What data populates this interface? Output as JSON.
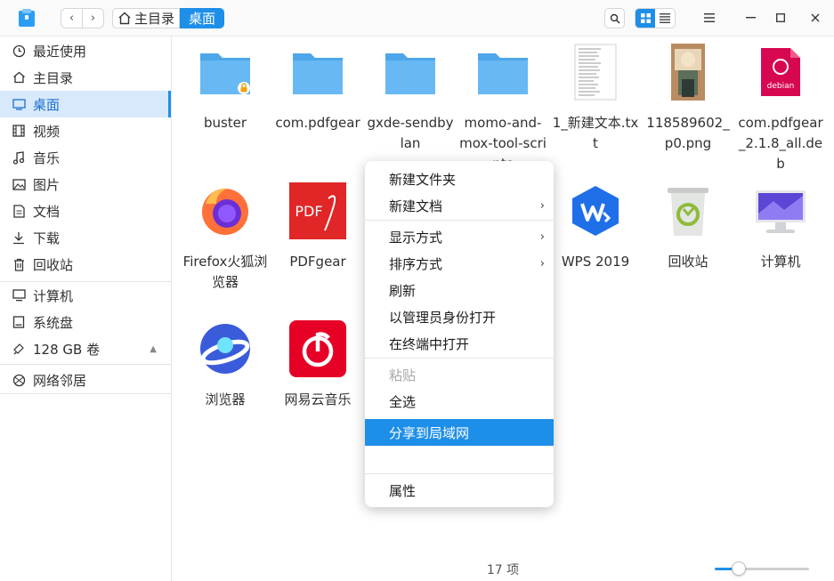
{
  "titlebar": {
    "breadcrumb_home": "主目录",
    "breadcrumb_current": "桌面"
  },
  "sidebar": {
    "items": [
      {
        "label": "最近使用",
        "icon": "clock-icon"
      },
      {
        "label": "主目录",
        "icon": "home-icon"
      },
      {
        "label": "桌面",
        "icon": "desktop-icon"
      },
      {
        "label": "视频",
        "icon": "video-icon"
      },
      {
        "label": "音乐",
        "icon": "music-icon"
      },
      {
        "label": "图片",
        "icon": "picture-icon"
      },
      {
        "label": "文档",
        "icon": "document-icon"
      },
      {
        "label": "下载",
        "icon": "download-icon"
      },
      {
        "label": "回收站",
        "icon": "trash-icon"
      },
      {
        "label": "计算机",
        "icon": "computer-icon"
      },
      {
        "label": "系统盘",
        "icon": "disk-icon"
      },
      {
        "label": "128 GB 卷",
        "icon": "usb-icon"
      },
      {
        "label": "网络邻居",
        "icon": "network-icon"
      }
    ]
  },
  "files": [
    {
      "name": "buster",
      "icon": "folder-locked-icon"
    },
    {
      "name": "com.pdfgear",
      "icon": "folder-icon"
    },
    {
      "name": "gxde-sendbylan",
      "icon": "folder-icon"
    },
    {
      "name": "momo-and-mox-tool-scripts",
      "icon": "folder-icon"
    },
    {
      "name": "1_新建文本.txt",
      "icon": "text-file-icon"
    },
    {
      "name": "118589602_p0.png",
      "icon": "image-file-icon"
    },
    {
      "name": "com.pdfgear_2.1.8_all.deb",
      "icon": "debian-package-icon",
      "badge": "debian"
    },
    {
      "name": "Firefox火狐浏览器",
      "icon": "firefox-icon"
    },
    {
      "name": "PDFgear",
      "icon": "pdfgear-icon",
      "badge": "PDF"
    },
    {
      "name": "WPS 2019",
      "icon": "wps-icon"
    },
    {
      "name": "回收站",
      "icon": "recycle-bin-icon"
    },
    {
      "name": "计算机",
      "icon": "computer-monitor-icon"
    },
    {
      "name": "浏览器",
      "icon": "browser-icon"
    },
    {
      "name": "网易云音乐",
      "icon": "netease-music-icon"
    }
  ],
  "status": {
    "count": "17 项",
    "zoom_level": 0.25
  },
  "context_menu": {
    "items": [
      {
        "label": "新建文件夹",
        "submenu": false,
        "state": "normal"
      },
      {
        "label": "新建文档",
        "submenu": true,
        "state": "normal"
      },
      {
        "label": "显示方式",
        "submenu": true,
        "state": "normal"
      },
      {
        "label": "排序方式",
        "submenu": true,
        "state": "normal"
      },
      {
        "label": "刷新",
        "submenu": false,
        "state": "normal"
      },
      {
        "label": "以管理员身份打开",
        "submenu": false,
        "state": "normal"
      },
      {
        "label": "在终端中打开",
        "submenu": false,
        "state": "normal"
      },
      {
        "label": "粘贴",
        "submenu": false,
        "state": "disabled"
      },
      {
        "label": "全选",
        "submenu": false,
        "state": "normal"
      },
      {
        "label": "分享到局域网",
        "submenu": false,
        "state": "highlighted"
      },
      {
        "label": "",
        "submenu": false,
        "state": "normal"
      },
      {
        "label": "属性",
        "submenu": false,
        "state": "normal"
      }
    ],
    "submenu_glyph": "›"
  },
  "colors": {
    "accent": "#1e8fe8",
    "folder": "#5aaef0"
  }
}
